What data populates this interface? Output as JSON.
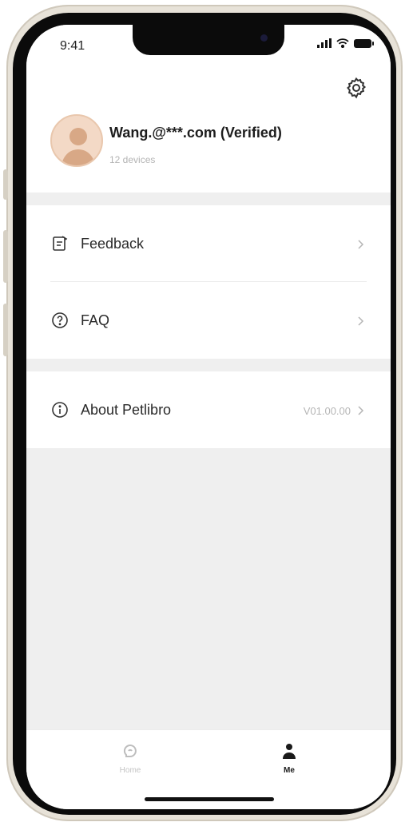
{
  "status_bar": {
    "time": "9:41"
  },
  "profile": {
    "username": "Wang.@***.com (Verified)",
    "device_count": "12 devices"
  },
  "menu": {
    "feedback": "Feedback",
    "faq": "FAQ",
    "about": "About Petlibro",
    "version": "V01.00.00"
  },
  "tabbar": {
    "home": "Home",
    "me": "Me",
    "active": "me"
  },
  "colors": {
    "background": "#efefef",
    "card": "#ffffff",
    "text_primary": "#2a2a2a",
    "text_muted": "#b3b3b3",
    "avatar_bg": "#f3d9c6"
  }
}
